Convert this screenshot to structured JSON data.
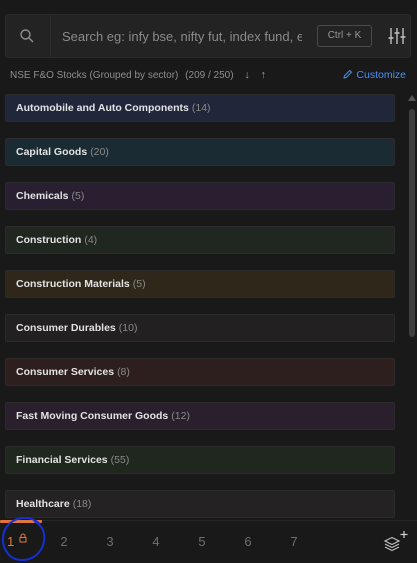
{
  "search": {
    "placeholder": "Search eg: infy bse, nifty fut, index fund, etc",
    "shortcut": "Ctrl + K"
  },
  "list_header": {
    "title": "NSE F&O Stocks (Grouped by sector)",
    "count": "(209 / 250)",
    "sort_down": "↓",
    "sort_up": "↑",
    "customize_label": "Customize"
  },
  "sectors": [
    {
      "name": "Automobile and Auto Components",
      "count": "(14)",
      "color": "#20273a"
    },
    {
      "name": "Capital Goods",
      "count": "(20)",
      "color": "#1b2b33"
    },
    {
      "name": "Chemicals",
      "count": "(5)",
      "color": "#2a1f30"
    },
    {
      "name": "Construction",
      "count": "(4)",
      "color": "#1f2720"
    },
    {
      "name": "Construction Materials",
      "count": "(5)",
      "color": "#30271b"
    },
    {
      "name": "Consumer Durables",
      "count": "(10)",
      "color": "#232021"
    },
    {
      "name": "Consumer Services",
      "count": "(8)",
      "color": "#2e1f1f"
    },
    {
      "name": "Fast Moving Consumer Goods",
      "count": "(12)",
      "color": "#2a1f2c"
    },
    {
      "name": "Financial Services",
      "count": "(55)",
      "color": "#1f271f"
    },
    {
      "name": "Healthcare",
      "count": "(18)",
      "color": "#242222"
    }
  ],
  "tabs": [
    {
      "label": "1",
      "active": true
    },
    {
      "label": "2"
    },
    {
      "label": "3"
    },
    {
      "label": "4"
    },
    {
      "label": "5"
    },
    {
      "label": "6"
    },
    {
      "label": "7"
    }
  ],
  "colors": {
    "accent": "#e0763b",
    "link": "#4c8ff0",
    "annotation": "#1330d8"
  }
}
